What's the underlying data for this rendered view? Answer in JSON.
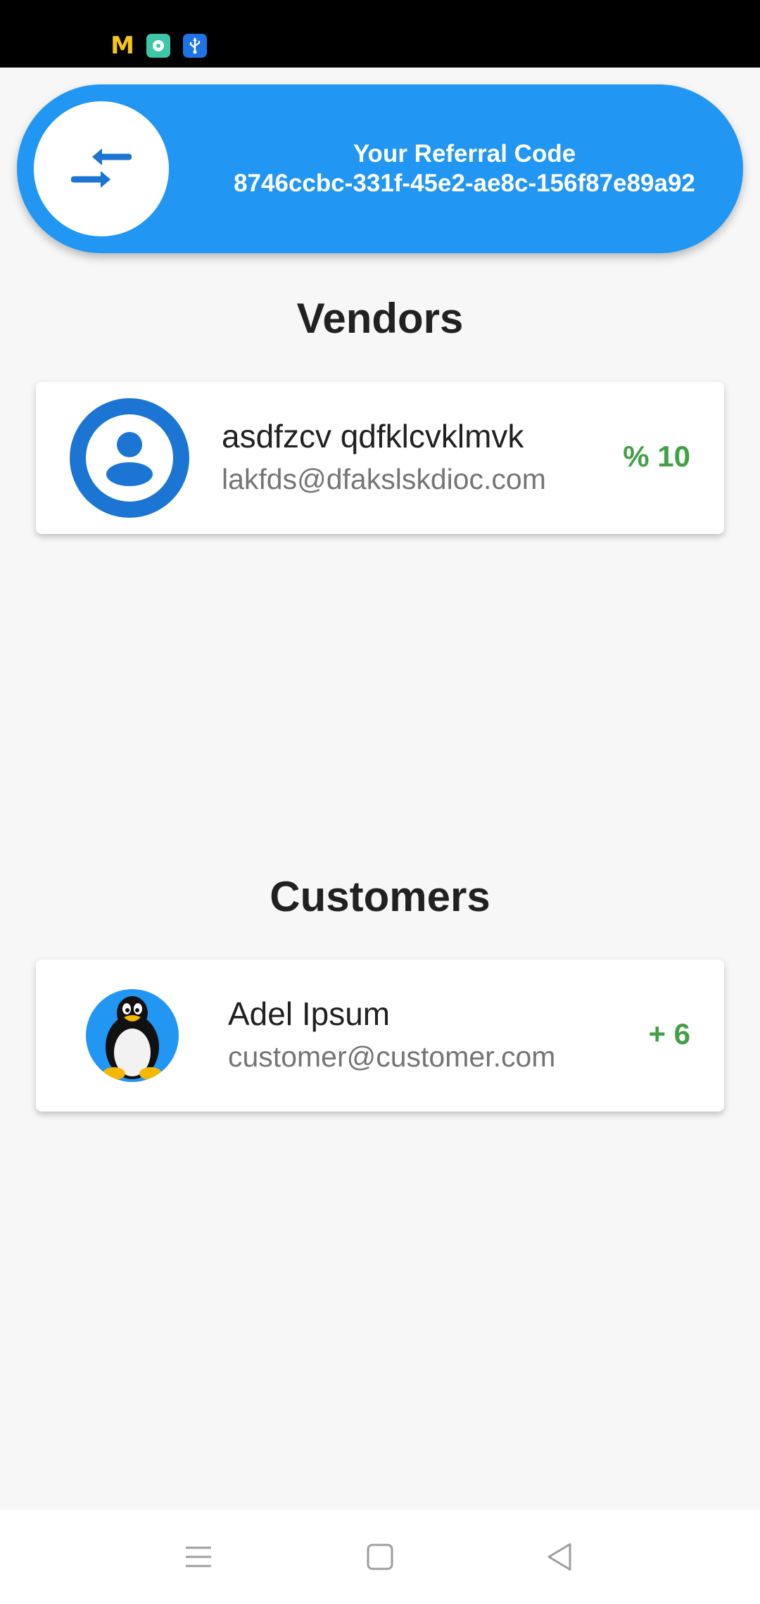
{
  "status_bar": {
    "icons": [
      "mcdonalds-icon",
      "chat-app-icon",
      "usb-icon"
    ],
    "mcd_glyph": "M"
  },
  "referral": {
    "icon": "swap-arrows-icon",
    "title": "Your Referral Code",
    "code": "8746ccbc-331f-45e2-ae8c-156f87e89a92",
    "color": "#2196f3"
  },
  "vendors": {
    "title": "Vendors",
    "items": [
      {
        "avatar": "account-circle-icon",
        "name": "asdfzcv qdfklcvklmvk",
        "email": "lakfds@dfakslskdioc.com",
        "value": "% 10"
      }
    ]
  },
  "customers": {
    "title": "Customers",
    "items": [
      {
        "avatar": "penguin-avatar",
        "name": "Adel Ipsum",
        "email": "customer@customer.com",
        "value": "+ 6"
      }
    ]
  },
  "colors": {
    "accent": "#2196f3",
    "value_green": "#43a047",
    "avatar_blue": "#1c75d2"
  },
  "nav_bar": {
    "buttons": [
      "menu-icon",
      "home-icon",
      "back-icon"
    ]
  }
}
